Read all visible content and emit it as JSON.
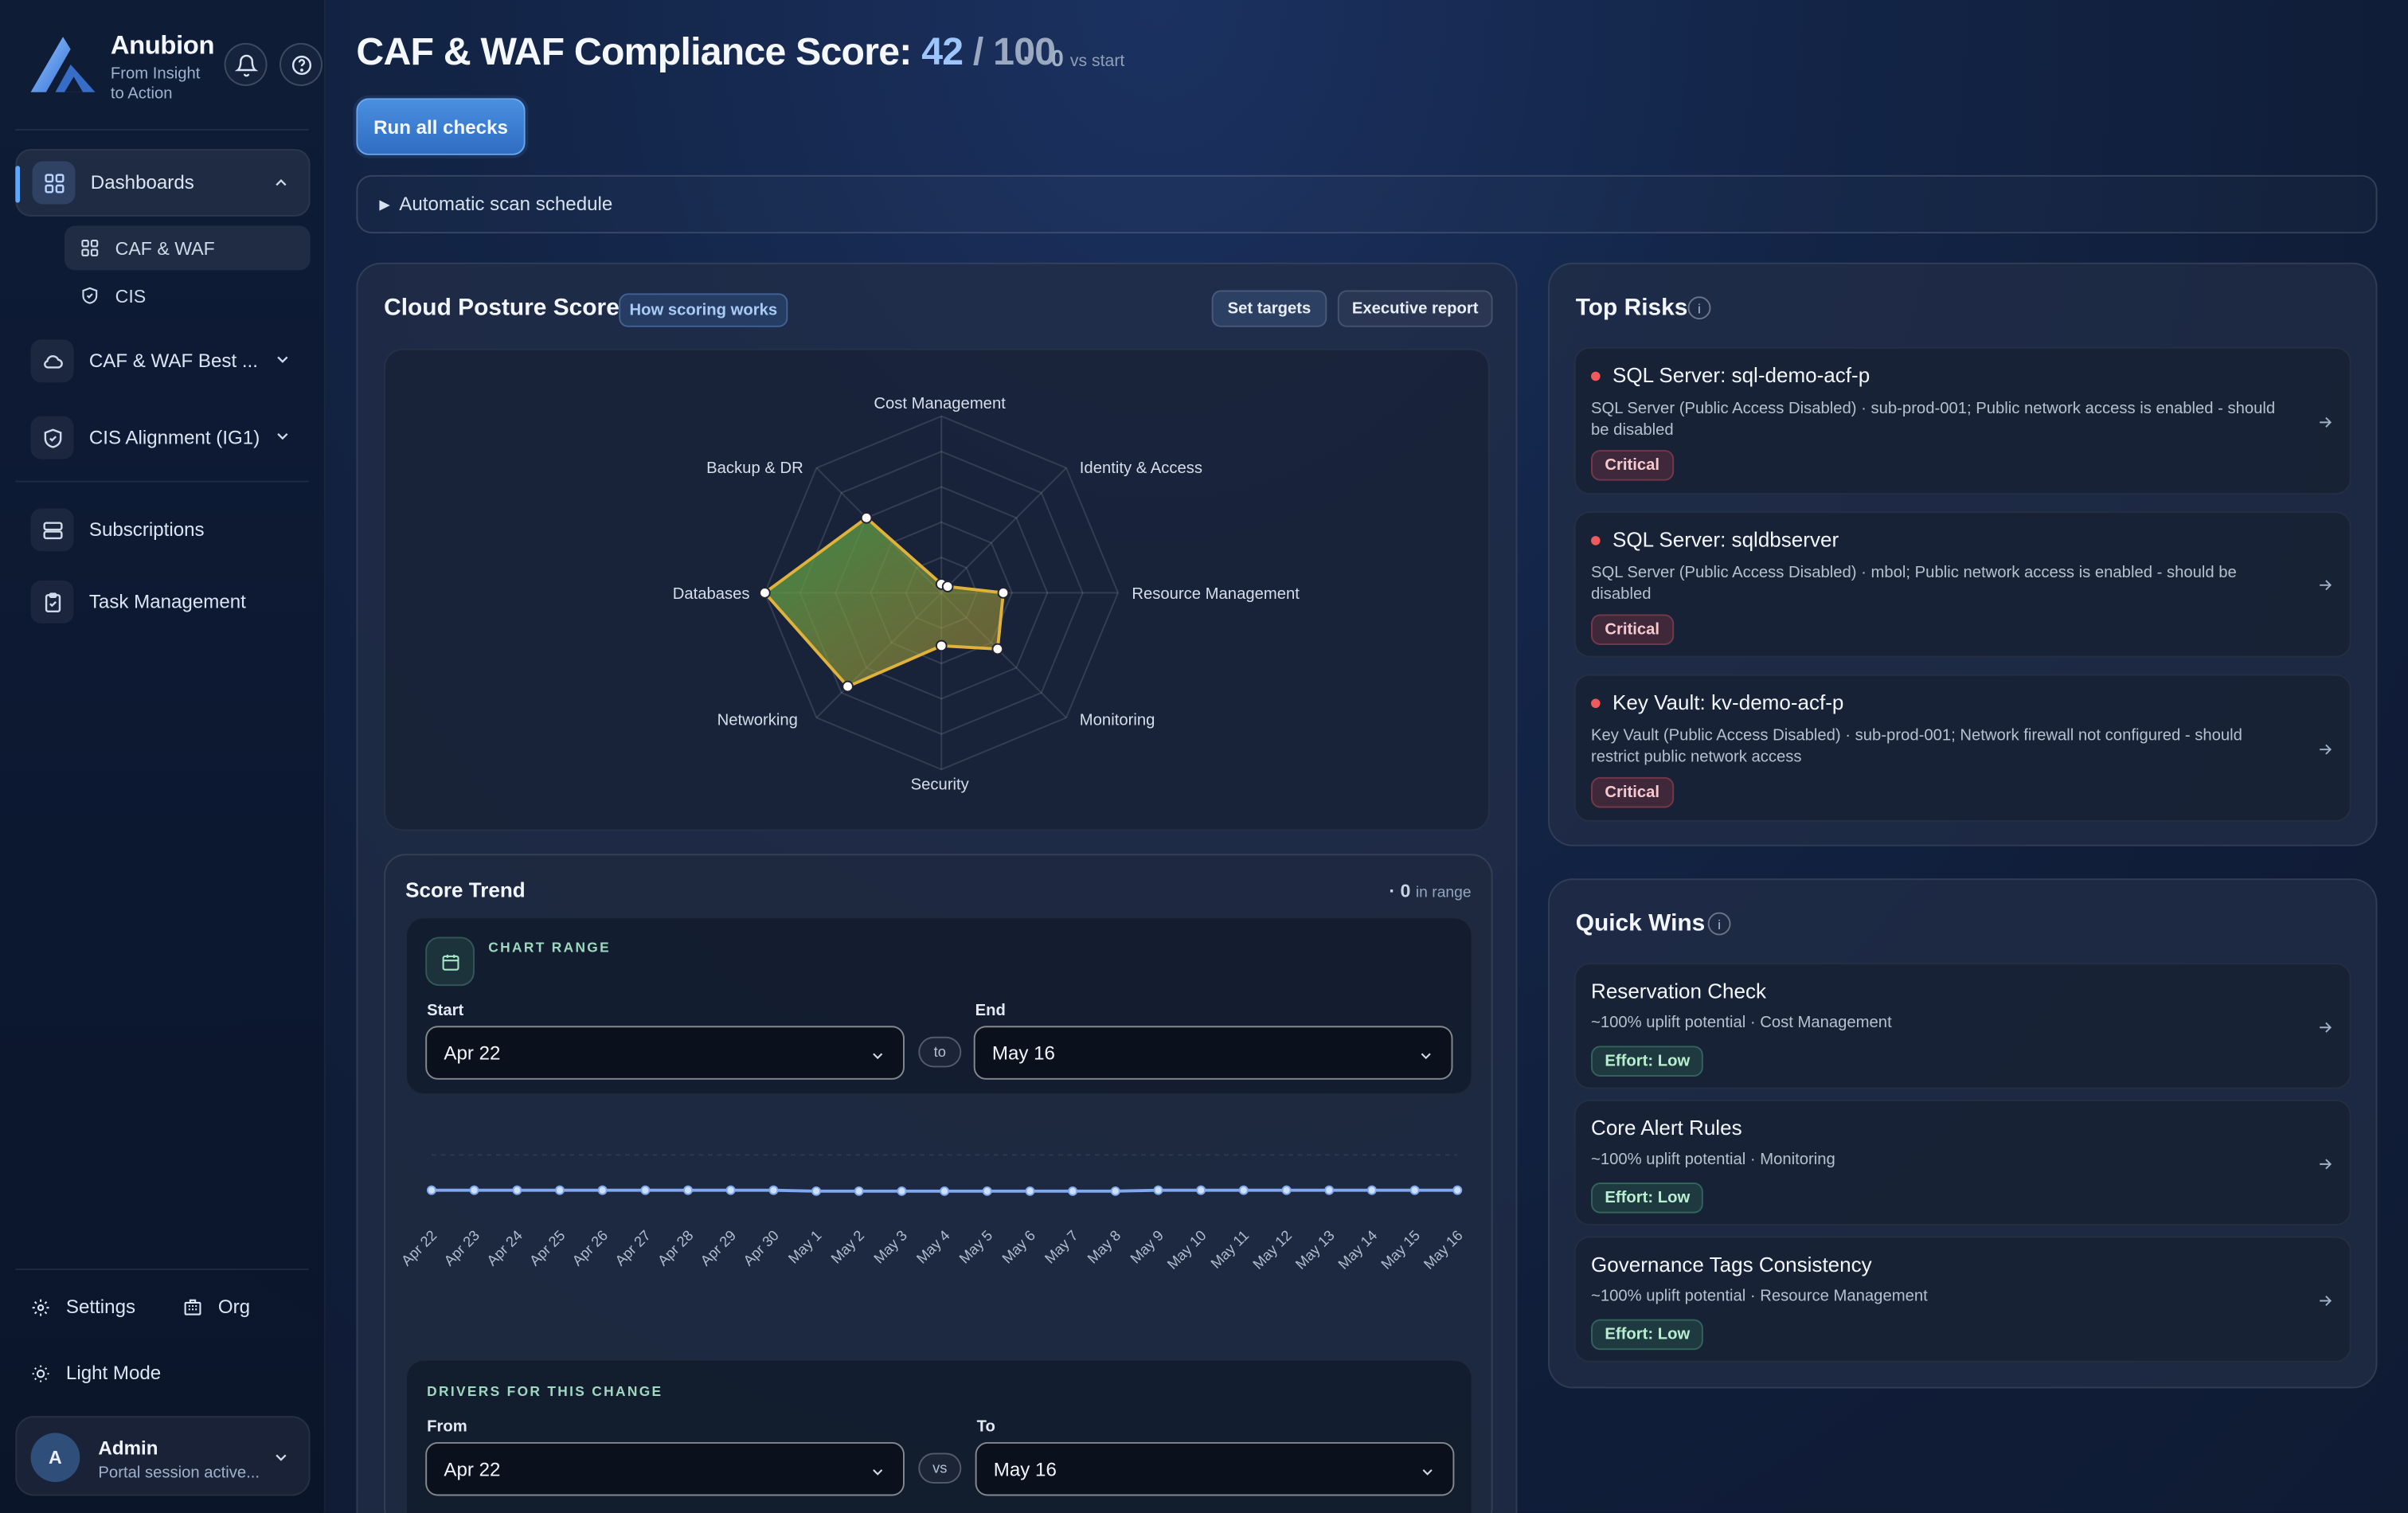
{
  "brand": {
    "name": "Anubion",
    "tagline_1": "From Insight",
    "tagline_2": "to Action"
  },
  "sidebar": {
    "dashboards": "Dashboards",
    "sub_items": [
      "CAF & WAF",
      "CIS"
    ],
    "caf_waf_best": "CAF & WAF Best ...",
    "cis_alignment": "CIS Alignment (IG1)",
    "subscriptions": "Subscriptions",
    "task_management": "Task Management",
    "settings": "Settings",
    "org": "Org",
    "light_mode": "Light Mode",
    "user_initial": "A",
    "user_name": "Admin",
    "user_status": "Portal session active..."
  },
  "header": {
    "title_prefix": "CAF & WAF Compliance Score:",
    "score": "42",
    "score_sep": "/",
    "score_max": "100",
    "delta": "· · 0",
    "delta_label": "vs start",
    "run_button": "Run all checks",
    "schedule_label": "Automatic scan schedule"
  },
  "posture": {
    "title": "Cloud Posture Score",
    "how_scoring": "How scoring works",
    "set_targets": "Set targets",
    "executive_report": "Executive report",
    "axes": [
      "Cost Management",
      "Identity & Access",
      "Resource Management",
      "Monitoring",
      "Security",
      "Networking",
      "Databases",
      "Backup & DR"
    ]
  },
  "chart_data": {
    "type": "radar",
    "categories": [
      "Cost Management",
      "Identity & Access",
      "Resource Management",
      "Monitoring",
      "Security",
      "Networking",
      "Databases",
      "Backup & DR"
    ],
    "values": [
      5,
      5,
      35,
      45,
      30,
      75,
      100,
      60
    ],
    "range": [
      0,
      100
    ],
    "color": "#e0b23a"
  },
  "trend": {
    "title": "Score Trend",
    "in_range_value": "· 0",
    "in_range_label": "in range",
    "chart_range": "CHART RANGE",
    "start_label": "Start",
    "end_label": "End",
    "start_value": "Apr 22",
    "end_value": "May 16",
    "to": "to",
    "dates": [
      "Apr 22",
      "Apr 23",
      "Apr 24",
      "Apr 25",
      "Apr 26",
      "Apr 27",
      "Apr 28",
      "Apr 29",
      "Apr 30",
      "May 1",
      "May 2",
      "May 3",
      "May 4",
      "May 5",
      "May 6",
      "May 7",
      "May 8",
      "May 9",
      "May 10",
      "May 11",
      "May 12",
      "May 13",
      "May 14",
      "May 15",
      "May 16"
    ],
    "line_color": "#7fa8f0",
    "drivers_title": "DRIVERS FOR THIS CHANGE",
    "from_label": "From",
    "to_label": "To",
    "from_value": "Apr 22",
    "to_value": "May 16",
    "vs": "vs"
  },
  "top_risks": {
    "title": "Top Risks",
    "info": "i",
    "items": [
      {
        "title": "SQL Server: sql-demo-acf-p",
        "desc": "SQL Server (Public Access Disabled) · sub-prod-001; Public network access is enabled - should be disabled",
        "severity": "Critical"
      },
      {
        "title": "SQL Server: sqldbserver",
        "desc": "SQL Server (Public Access Disabled) · mbol; Public network access is enabled - should be disabled",
        "severity": "Critical"
      },
      {
        "title": "Key Vault: kv-demo-acf-p",
        "desc": "Key Vault (Public Access Disabled) · sub-prod-001; Network firewall not configured - should restrict public network access",
        "severity": "Critical"
      }
    ]
  },
  "quick_wins": {
    "title": "Quick Wins",
    "info": "i",
    "items": [
      {
        "title": "Reservation Check",
        "desc": "~100% uplift potential · Cost Management",
        "effort": "Effort: Low"
      },
      {
        "title": "Core Alert Rules",
        "desc": "~100% uplift potential · Monitoring",
        "effort": "Effort: Low"
      },
      {
        "title": "Governance Tags Consistency",
        "desc": "~100% uplift potential · Resource Management",
        "effort": "Effort: Low"
      }
    ]
  }
}
